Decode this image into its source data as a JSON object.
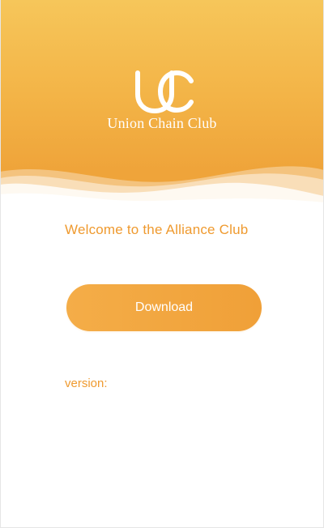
{
  "header": {
    "logo_icon": "uc-logo-icon",
    "brand_name": "Union Chain Club"
  },
  "main": {
    "welcome_text": "Welcome to the Alliance Club",
    "download_label": "Download",
    "version_label": "version:"
  },
  "colors": {
    "accent": "#ef9a2f",
    "header_top": "#f6c65a",
    "header_bottom": "#efa43a",
    "button": "#f2a640",
    "text_on_accent": "#ffffff"
  }
}
